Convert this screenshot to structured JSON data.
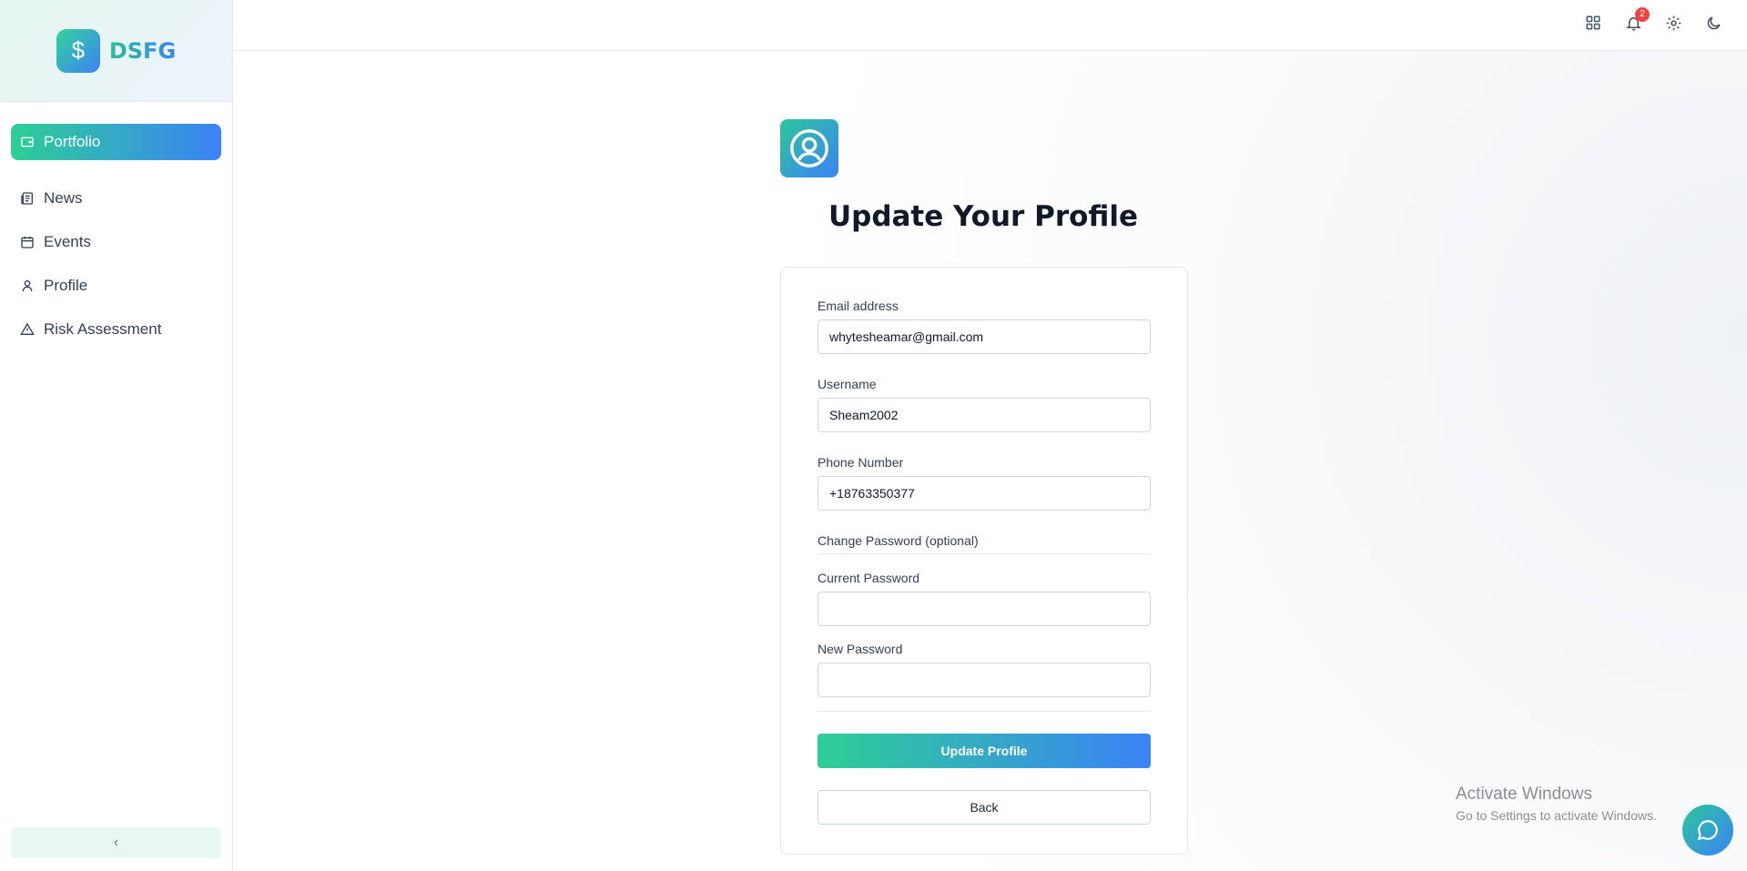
{
  "brand": {
    "logo_glyph": "$",
    "name": "DSFG"
  },
  "sidebar": {
    "items": [
      {
        "label": "Portfolio",
        "icon": "wallet-icon",
        "active": true
      },
      {
        "label": "News",
        "icon": "newspaper-icon"
      },
      {
        "label": "Events",
        "icon": "calendar-icon"
      },
      {
        "label": "Profile",
        "icon": "user-icon"
      },
      {
        "label": "Risk Assessment",
        "icon": "warning-triangle-icon"
      }
    ],
    "collapse_glyph": "‹"
  },
  "topbar": {
    "icons": [
      "apps-grid-icon",
      "bell-icon",
      "gear-icon",
      "moon-icon"
    ],
    "notification_count": "2"
  },
  "main": {
    "title": "Update Your Profile",
    "form": {
      "email_label": "Email address",
      "email_value": "whytesheamar@gmail.com",
      "username_label": "Username",
      "username_value": "Sheam2002",
      "phone_label": "Phone Number",
      "phone_value": "+18763350377",
      "change_password_heading": "Change Password (optional)",
      "current_password_label": "Current Password",
      "current_password_value": "",
      "new_password_label": "New Password",
      "new_password_value": "",
      "submit_label": "Update Profile",
      "back_label": "Back"
    }
  },
  "watermark": {
    "line1": "Activate Windows",
    "line2": "Go to Settings to activate Windows."
  },
  "colors": {
    "accent_start": "#2ecf96",
    "accent_end": "#3b82f6",
    "badge": "#ef4444"
  }
}
